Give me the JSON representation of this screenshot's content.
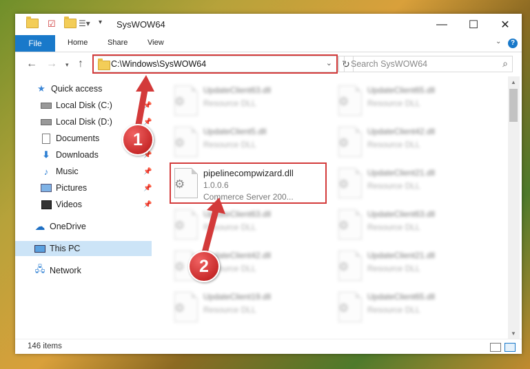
{
  "window": {
    "title": "SysWOW64",
    "controls": {
      "minimize": "—",
      "maximize": "☐",
      "close": "✕"
    }
  },
  "ribbon": {
    "tabs": [
      "File",
      "Home",
      "Share",
      "View"
    ],
    "help": "?"
  },
  "address": {
    "path": "C:\\Windows\\SysWOW64"
  },
  "search": {
    "placeholder": "Search SysWOW64"
  },
  "sidebar": {
    "items": [
      {
        "label": "Quick access",
        "icon": "star-icon"
      },
      {
        "label": "Local Disk (C:)",
        "icon": "drive-icon"
      },
      {
        "label": "Local Disk (D:)",
        "icon": "drive-icon"
      },
      {
        "label": "Documents",
        "icon": "documents-icon"
      },
      {
        "label": "Downloads",
        "icon": "downloads-icon"
      },
      {
        "label": "Music",
        "icon": "music-icon"
      },
      {
        "label": "Pictures",
        "icon": "pictures-icon"
      },
      {
        "label": "Videos",
        "icon": "videos-icon"
      },
      {
        "label": "OneDrive",
        "icon": "cloud-icon"
      },
      {
        "label": "This PC",
        "icon": "computer-icon"
      },
      {
        "label": "Network",
        "icon": "network-icon"
      }
    ]
  },
  "files": {
    "highlighted": {
      "name": "pipelinecompwizard.dll",
      "version": "1.0.0.6",
      "description": "Commerce Server 200..."
    },
    "left": [
      {
        "name": "UpdateClient63.dll",
        "type": "Resource DLL"
      },
      {
        "name": "UpdateClient5.dll",
        "type": "Resource DLL"
      },
      {
        "name": "UpdateClient63.dll",
        "type": "Resource DLL"
      },
      {
        "name": "UpdateClient42.dll",
        "type": "Resource DLL"
      },
      {
        "name": "UpdateClient19.dll",
        "type": "Resource DLL"
      }
    ],
    "right": [
      {
        "name": "UpdateClient65.dll",
        "type": "Resource DLL"
      },
      {
        "name": "UpdateClient42.dll",
        "type": "Resource DLL"
      },
      {
        "name": "UpdateClient21.dll",
        "type": "Resource DLL"
      },
      {
        "name": "UpdateClient63.dll",
        "type": "Resource DLL"
      },
      {
        "name": "UpdateClient21.dll",
        "type": "Resource DLL"
      },
      {
        "name": "UpdateClient65.dll",
        "type": "Resource DLL"
      }
    ]
  },
  "status": {
    "count": "146 items"
  },
  "annotations": {
    "step1": "1",
    "step2": "2",
    "color": "#d33a3a"
  }
}
